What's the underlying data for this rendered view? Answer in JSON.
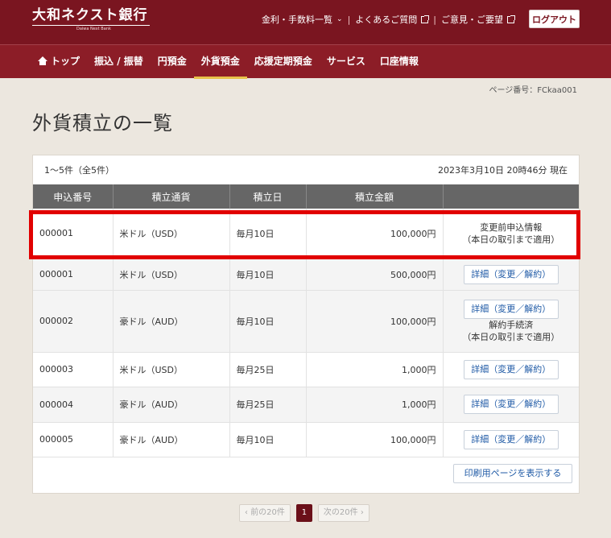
{
  "header": {
    "logo_text": "大和ネクスト銀行",
    "logo_sub": "Daiwa Next Bank",
    "links": [
      "金利・手数料一覧",
      "よくあるご質問",
      "ご意見・ご要望"
    ],
    "separator": "|",
    "logout": "ログアウト"
  },
  "nav": {
    "items": [
      "トップ",
      "振込 / 振替",
      "円預金",
      "外貨預金",
      "応援定期預金",
      "サービス",
      "口座情報"
    ],
    "active_index": 3,
    "active_color": "#e8c24a"
  },
  "page": {
    "page_number": "ページ番号：FCkaa001",
    "title": "外貨積立の一覧"
  },
  "table": {
    "range_text": "1～5件（全5件）",
    "timestamp": "2023年3月10日 20時46分 現在",
    "headers": [
      "申込番号",
      "積立通貨",
      "積立日",
      "積立金額",
      ""
    ],
    "rows": [
      {
        "id": "000001",
        "currency": "米ドル（USD）",
        "day": "毎月10日",
        "amount": "100,000円",
        "note1": "変更前申込情報",
        "note2": "（本日の取引まで適用）"
      },
      {
        "id": "000001",
        "currency": "米ドル（USD）",
        "day": "毎月10日",
        "amount": "500,000円",
        "action": "詳細（変更／解約）"
      },
      {
        "id": "000002",
        "currency": "豪ドル（AUD）",
        "day": "毎月10日",
        "amount": "100,000円",
        "action": "詳細（変更／解約）",
        "note1": "解約手続済",
        "note2": "（本日の取引まで適用）"
      },
      {
        "id": "000003",
        "currency": "米ドル（USD）",
        "day": "毎月25日",
        "amount": "1,000円",
        "action": "詳細（変更／解約）"
      },
      {
        "id": "000004",
        "currency": "豪ドル（AUD）",
        "day": "毎月25日",
        "amount": "1,000円",
        "action": "詳細（変更／解約）"
      },
      {
        "id": "000005",
        "currency": "豪ドル（AUD）",
        "day": "毎月10日",
        "amount": "100,000円",
        "action": "詳細（変更／解約）"
      }
    ],
    "print_button": "印刷用ページを表示する"
  },
  "pager": {
    "prev": "前の20件",
    "current": "1",
    "next": "次の20件"
  },
  "colors": {
    "brand": "#7a1520",
    "highlight": "#e10000"
  }
}
